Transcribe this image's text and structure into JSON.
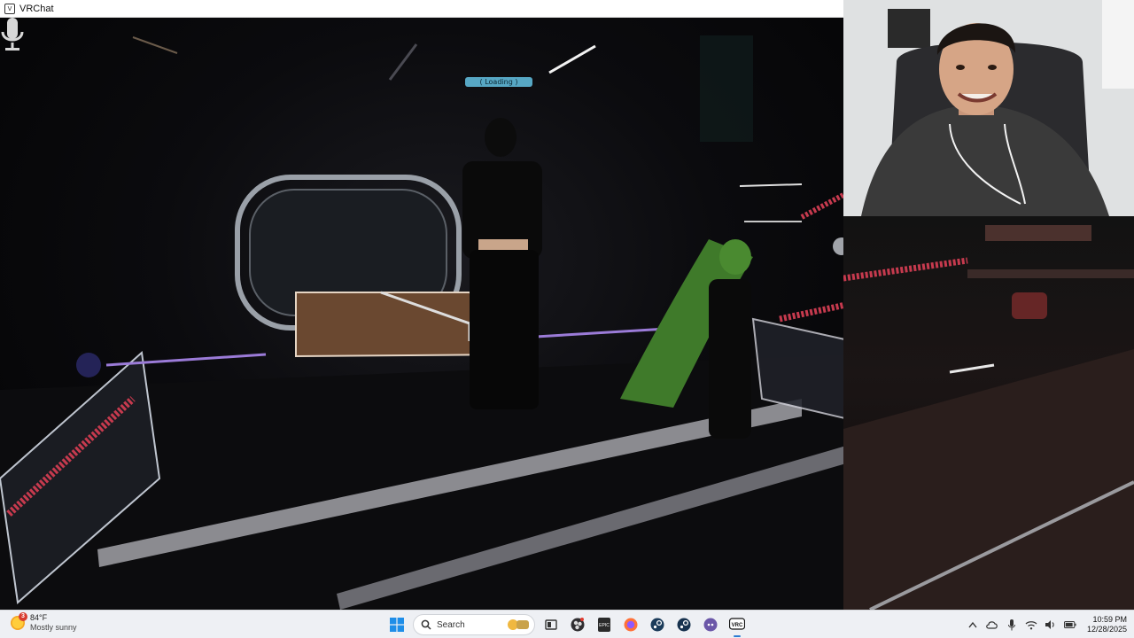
{
  "window": {
    "title": "VRChat",
    "app_icon": "vrchat-window-icon"
  },
  "scene": {
    "description_icon": "microphone-icon",
    "nameplate_text": "( Loading )"
  },
  "webcam": {
    "icon": "webcam-feed"
  },
  "taskbar": {
    "weather": {
      "badge": "3",
      "temperature": "84°F",
      "condition": "Mostly sunny"
    },
    "start_icon": "windows-start-icon",
    "search": {
      "placeholder": "Search"
    },
    "pinned_apps": [
      {
        "name": "task-view-icon"
      },
      {
        "name": "obs-icon"
      },
      {
        "name": "epic-games-icon",
        "label": "EPIC"
      },
      {
        "name": "firefox-icon"
      },
      {
        "name": "steam-icon"
      },
      {
        "name": "steam-alt-icon"
      },
      {
        "name": "discord-like-icon"
      },
      {
        "name": "vrchat-icon",
        "label": "VRC"
      }
    ],
    "tray_icons": [
      "chevron-up-icon",
      "cloud-icon",
      "microphone-tray-icon",
      "wifi-icon",
      "volume-icon",
      "battery-icon"
    ],
    "clock": {
      "time": "10:59 PM",
      "date": "12/28/2025"
    }
  },
  "colors": {
    "taskbar_bg": "#eef0f4",
    "accent": "#2b7cd3",
    "rail_pink": "#c63a4e",
    "avatar_green": "#3f7a2a"
  }
}
